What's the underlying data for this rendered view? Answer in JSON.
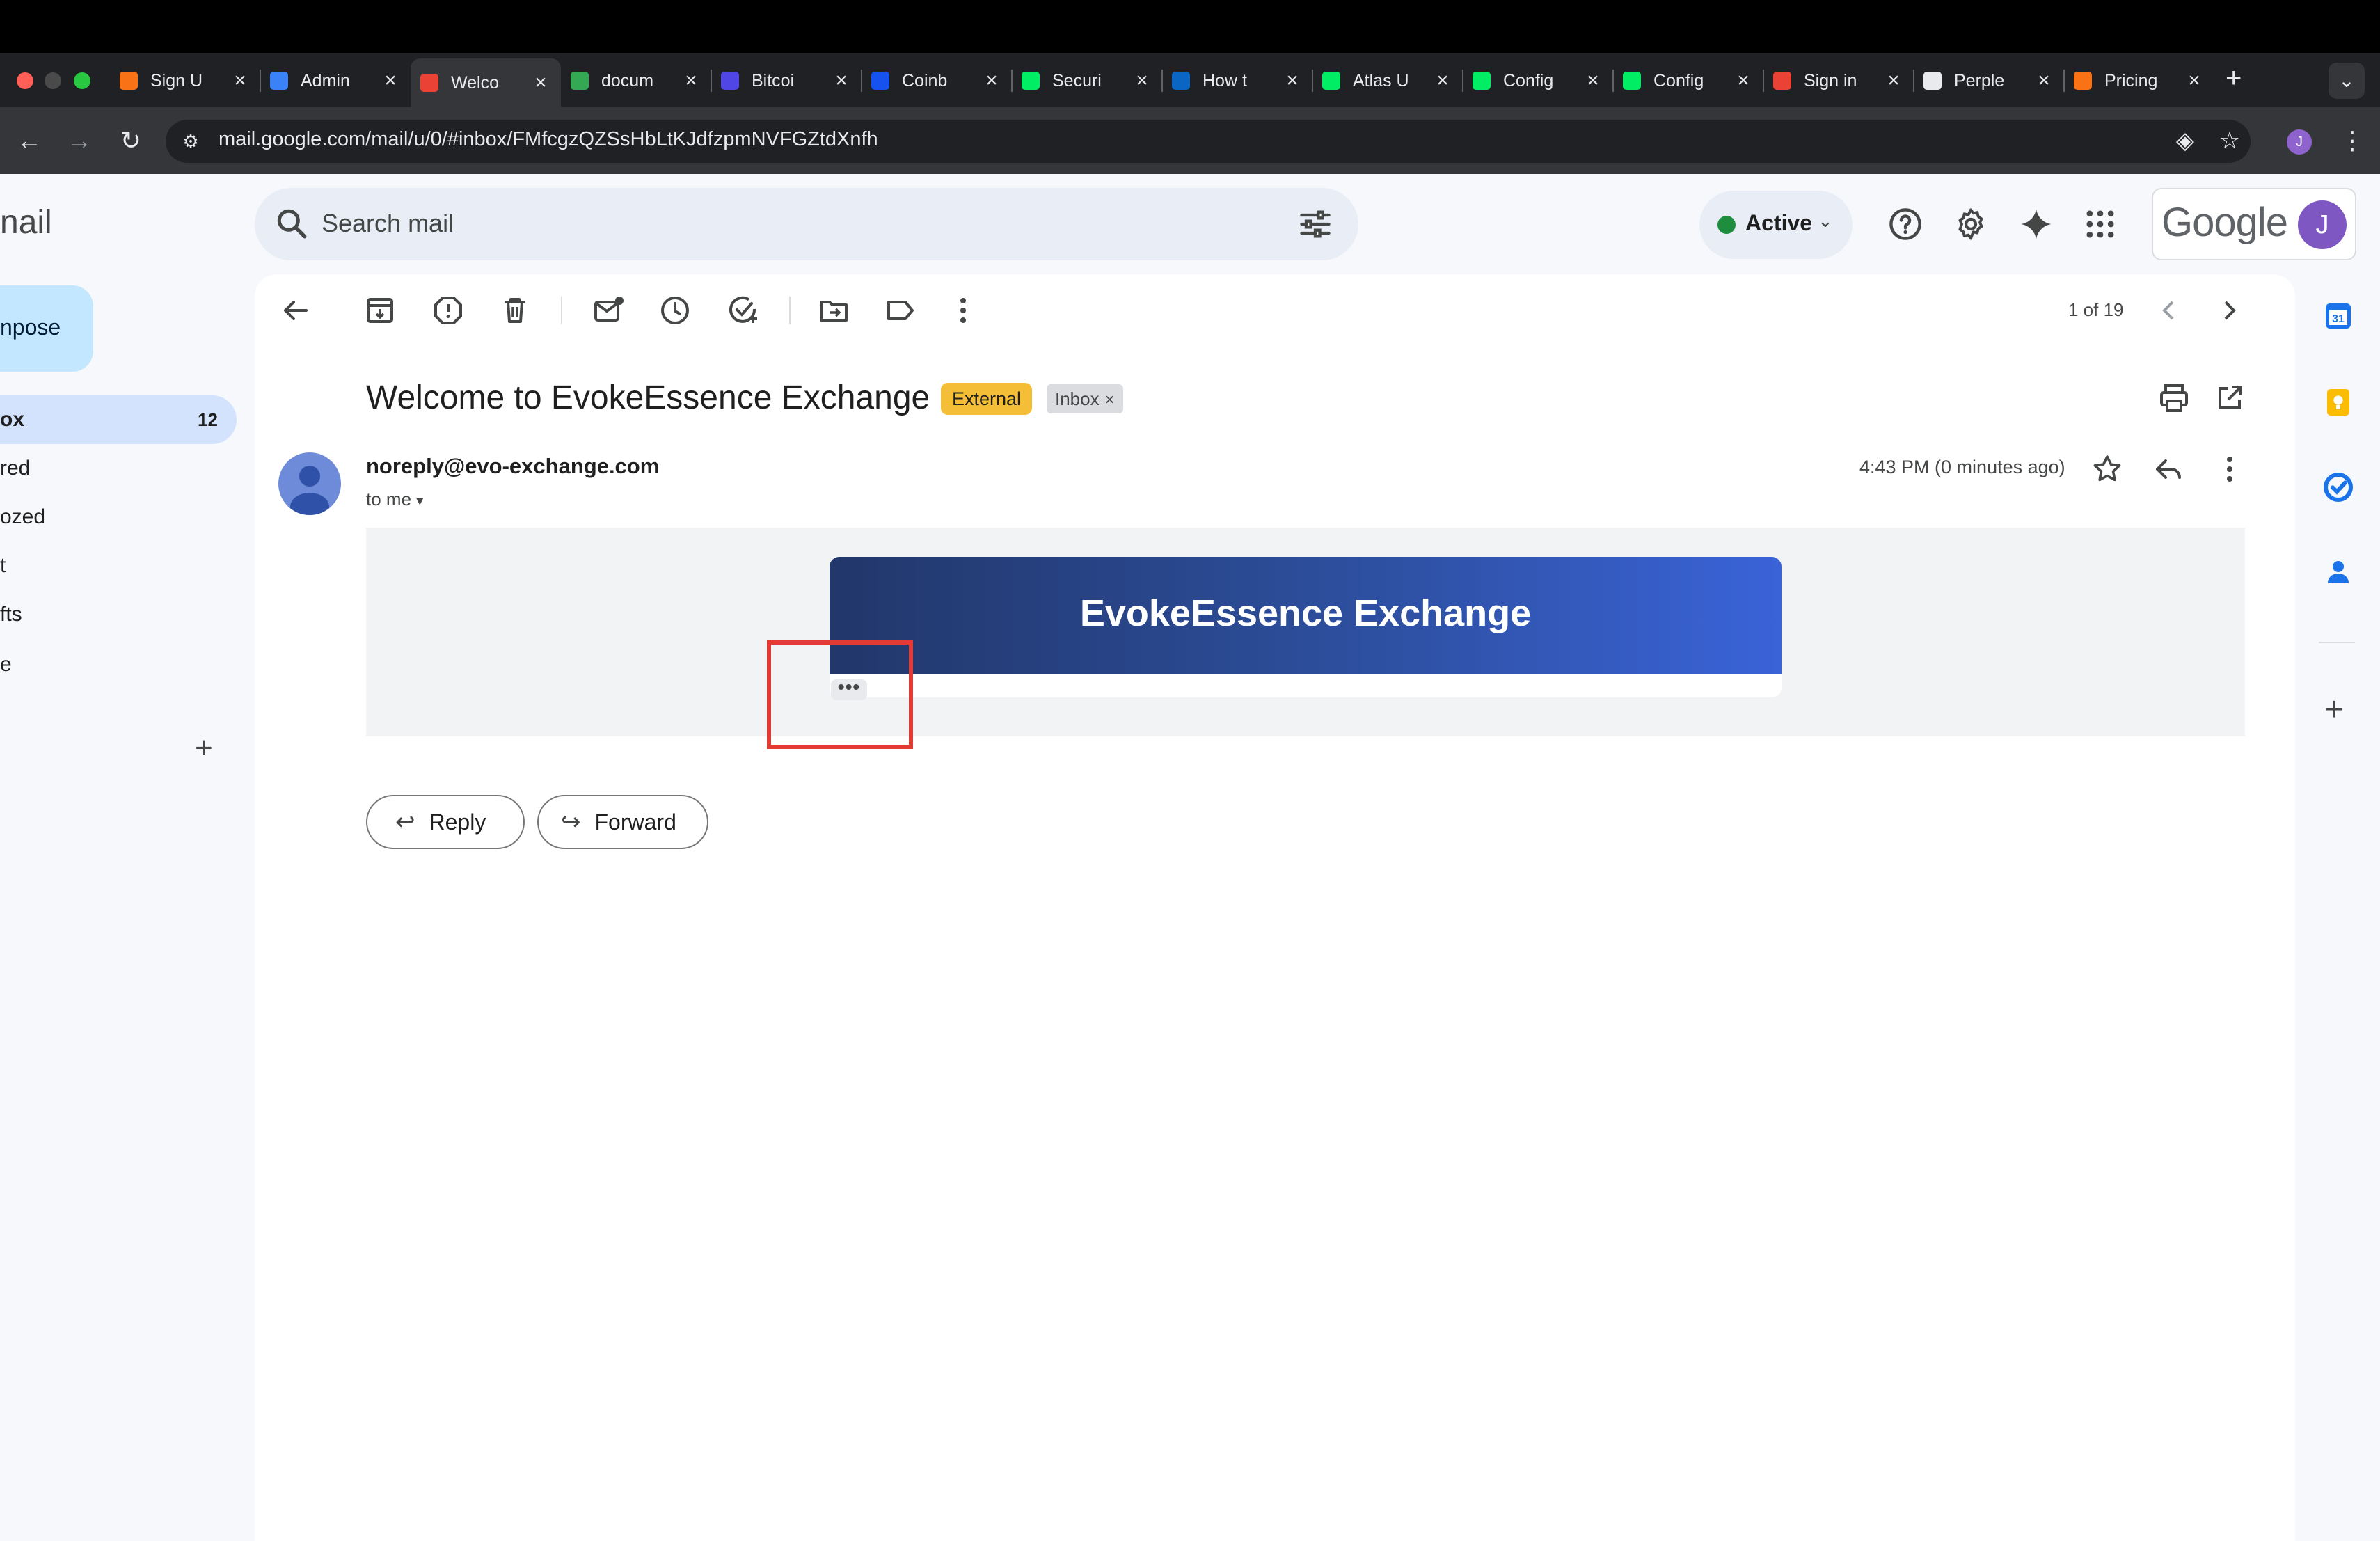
{
  "browser": {
    "tabs": [
      {
        "title": "Sign U",
        "icon": "orange-tab-icon",
        "color": "#f97316"
      },
      {
        "title": "Admin",
        "icon": "blue-hex-tab-icon",
        "color": "#3b82f6"
      },
      {
        "title": "Welco",
        "icon": "gmail-tab-icon",
        "color": "#ea4335",
        "active": true
      },
      {
        "title": "docum",
        "icon": "google-drive-tab-icon",
        "color": "#34a853"
      },
      {
        "title": "Bitcoi",
        "icon": "bitcoin-tab-icon",
        "color": "#4f46e5"
      },
      {
        "title": "Coinb",
        "icon": "coinbase-tab-icon",
        "color": "#1652f0"
      },
      {
        "title": "Securi",
        "icon": "mongodb-leaf-tab-icon",
        "color": "#00ed64"
      },
      {
        "title": "How t",
        "icon": "linkedin-tab-icon",
        "color": "#0a66c2"
      },
      {
        "title": "Atlas U",
        "icon": "mongodb-leaf-tab-icon",
        "color": "#00ed64"
      },
      {
        "title": "Config",
        "icon": "mongodb-leaf-tab-icon",
        "color": "#00ed64"
      },
      {
        "title": "Config",
        "icon": "mongodb-leaf-tab-icon",
        "color": "#00ed64"
      },
      {
        "title": "Sign in",
        "icon": "gmail-tab-icon",
        "color": "#ea4335"
      },
      {
        "title": "Perple",
        "icon": "perplexity-tab-icon",
        "color": "#e8eaed"
      },
      {
        "title": "Pricing",
        "icon": "orange-tab-icon",
        "color": "#f97316"
      }
    ],
    "close_glyph": "×",
    "new_tab_glyph": "+",
    "url": "mail.google.com/mail/u/0/#inbox/FMfcgzQZSsHbLtKJdfzpmNVFGZtdXnfh",
    "profile_initial": "J"
  },
  "gmail": {
    "logo_text": "nail",
    "search_placeholder": "Search mail",
    "status": "Active",
    "google_word": "Google",
    "account_initial": "J",
    "compose_label": "npose",
    "nav": [
      {
        "label": "ox",
        "count": "12",
        "active": true
      },
      {
        "label": "red"
      },
      {
        "label": "ozed"
      },
      {
        "label": "t"
      },
      {
        "label": "fts"
      },
      {
        "label": "e"
      }
    ],
    "labels_add": "+"
  },
  "message": {
    "pager": "1 of 19",
    "subject": "Welcome to EvokeEssence Exchange",
    "badge_external": "External",
    "badge_inbox": "Inbox",
    "badge_close": "×",
    "sender": "noreply@evo-exchange.com",
    "to_me": "to me",
    "timestamp": "4:43 PM (0 minutes ago)",
    "banner_title": "EvokeEssence Exchange",
    "trimmed_content": "•••",
    "reply_label": "Reply",
    "forward_label": "Forward"
  },
  "colors": {
    "accent_highlight": "#e53935",
    "banner_start": "#22376a",
    "banner_end": "#3a63d8",
    "external_badge": "#f4bf36",
    "status_online": "#1e8e3e"
  }
}
